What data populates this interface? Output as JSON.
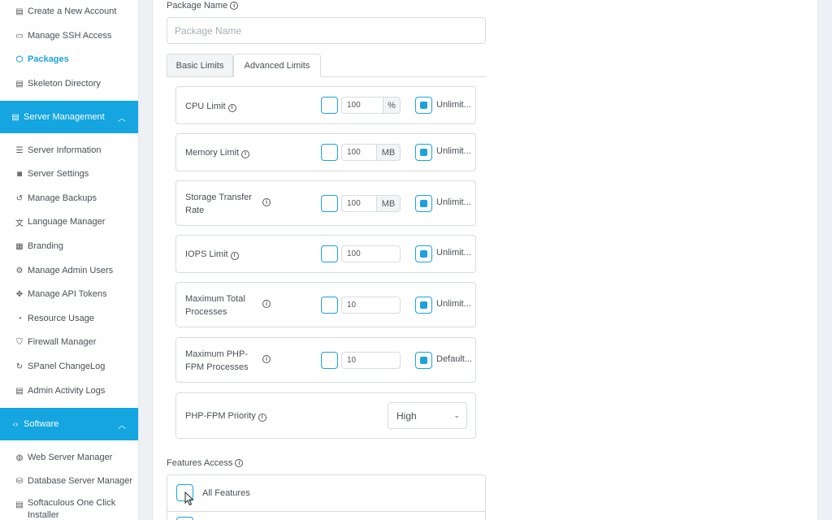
{
  "sidebar": {
    "top_items": [
      {
        "label": "Create a New Account",
        "icon": "calendar-icon"
      },
      {
        "label": "Manage SSH Access",
        "icon": "terminal-icon"
      },
      {
        "label": "Packages",
        "icon": "package-icon",
        "active": true
      },
      {
        "label": "Skeleton Directory",
        "icon": "skeleton-icon"
      }
    ],
    "server_management": {
      "label": "Server Management",
      "items": [
        {
          "label": "Server Information",
          "icon": "list-icon"
        },
        {
          "label": "Server Settings",
          "icon": "settings-icon"
        },
        {
          "label": "Manage Backups",
          "icon": "backup-icon"
        },
        {
          "label": "Language Manager",
          "icon": "translate-icon"
        },
        {
          "label": "Branding",
          "icon": "grid-icon"
        },
        {
          "label": "Manage Admin Users",
          "icon": "user-gear-icon"
        },
        {
          "label": "Manage API Tokens",
          "icon": "api-icon"
        },
        {
          "label": "Resource Usage",
          "icon": "gauge-icon"
        },
        {
          "label": "Firewall Manager",
          "icon": "shield-icon"
        },
        {
          "label": "SPanel ChangeLog",
          "icon": "changelog-icon"
        },
        {
          "label": "Admin Activity Logs",
          "icon": "log-icon"
        }
      ]
    },
    "software": {
      "label": "Software",
      "items": [
        {
          "label": "Web Server Manager",
          "icon": "globe-icon"
        },
        {
          "label": "Database Server Manager",
          "icon": "database-icon"
        },
        {
          "label": "Softaculous One Click Installer",
          "icon": "softaculous-icon"
        }
      ]
    }
  },
  "form": {
    "package_name_label": "Package Name",
    "package_name_placeholder": "Package Name",
    "tabs": {
      "basic": "Basic Limits",
      "advanced": "Advanced Limits"
    },
    "limits": [
      {
        "label": "CPU Limit",
        "value": "100",
        "unit": "%",
        "toggle_label": "Unlimit..."
      },
      {
        "label": "Memory Limit",
        "value": "100",
        "unit": "MB",
        "toggle_label": "Unlimit..."
      },
      {
        "label": "Storage Transfer Rate",
        "value": "100",
        "unit": "MB",
        "toggle_label": "Unlimit..."
      },
      {
        "label": "IOPS Limit",
        "value": "100",
        "unit": "",
        "toggle_label": "Unlimit..."
      },
      {
        "label": "Maximum Total Processes",
        "value": "10",
        "unit": "",
        "toggle_label": "Unlimit..."
      },
      {
        "label": "Maximum PHP-FPM Processes",
        "value": "10",
        "unit": "",
        "toggle_label": "Default..."
      }
    ],
    "php_fpm_priority": {
      "label": "PHP-FPM Priority",
      "value": "High"
    },
    "features_access_label": "Features Access",
    "all_features_label": "All Features"
  },
  "colors": {
    "accent": "#15a5e0",
    "active_text": "#1da1de"
  }
}
